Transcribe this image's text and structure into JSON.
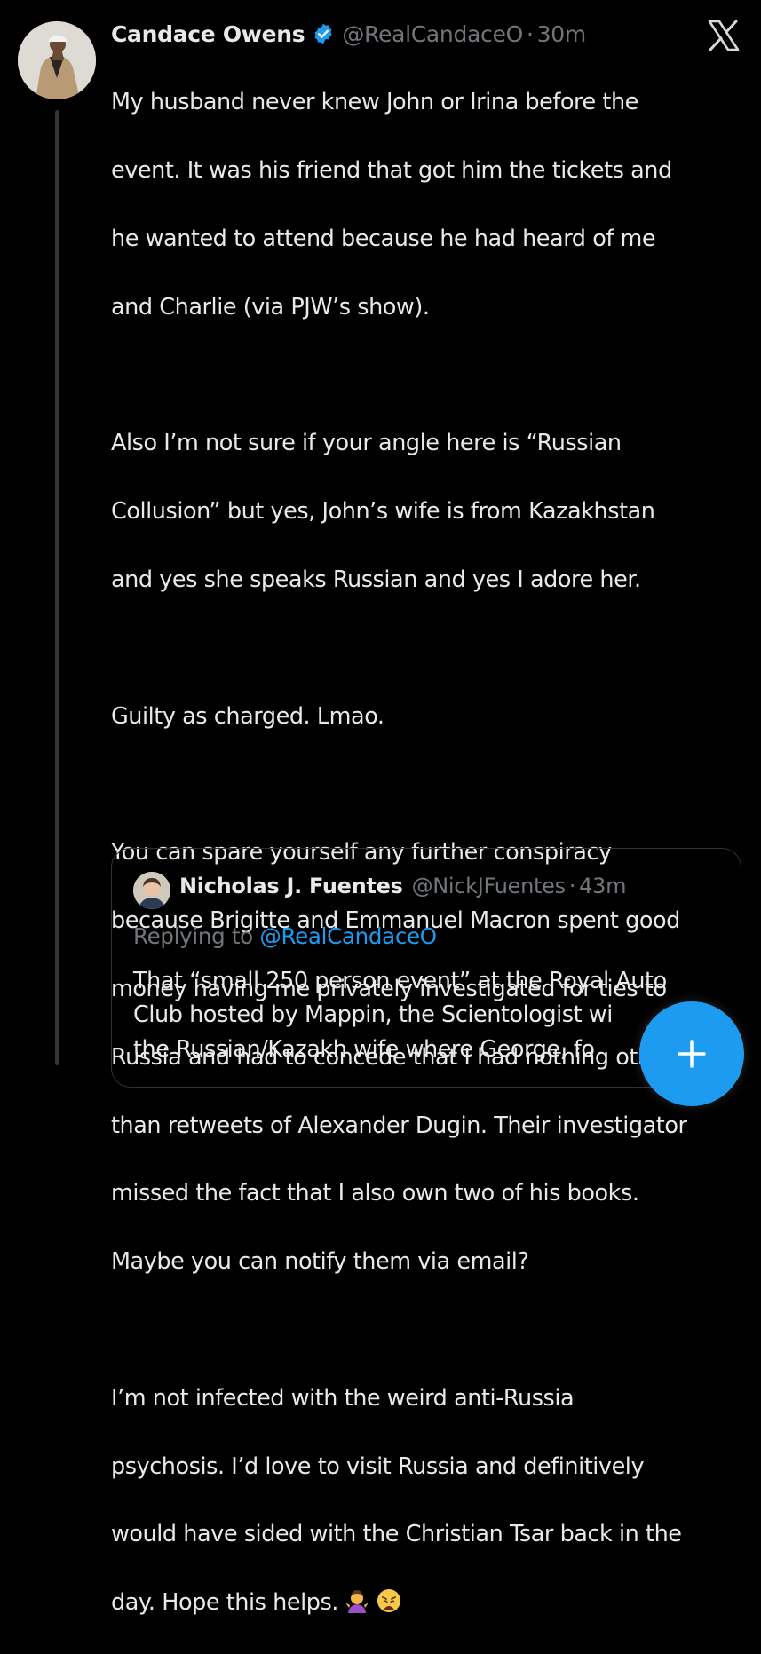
{
  "tweet": {
    "author": {
      "display_name": "Candace Owens",
      "handle": "@RealCandaceO",
      "verified_color": "#1d9bf0"
    },
    "separator": "·",
    "time": "30m",
    "lines": [
      "My husband never knew John or Irina before the",
      "event. It was his friend that got him the tickets and",
      "he wanted to attend because he had heard of me",
      "and Charlie (via PJW’s show).",
      "",
      "Also I’m not sure if your angle here is “Russian",
      "Collusion” but yes, John’s wife is from Kazakhstan",
      "and yes she speaks Russian and yes I adore her.",
      "",
      "Guilty as charged. Lmao.",
      "",
      "You can spare yourself any further conspiracy",
      "because Brigitte and Emmanuel Macron spent good",
      "money having me privately investigated for ties to",
      "Russia and had to concede that I had nothing other",
      "than retweets of Alexander Dugin. Their investigator",
      "missed the fact that I also own two of his books.",
      "Maybe you can notify them via email?",
      "",
      "I’m not infected with the weird anti-Russia",
      "psychosis. I’d love to visit Russia and definitively",
      "would have sided with the Christian Tsar back in the"
    ],
    "last_line": "day. Hope this helps.",
    "emojis": [
      "woman-shrugging-emoji",
      "weary-face-emoji"
    ]
  },
  "quoted_tweet": {
    "author": {
      "display_name": "Nicholas J. Fuentes",
      "handle": "@NickJFuentes"
    },
    "separator": "·",
    "time": "43m",
    "replying_prefix": "Replying to",
    "replying_handle": "@RealCandaceO",
    "lines": [
      "That “small 250 person event” at the Royal Auto",
      "Club hosted by Mappin, the Scientologist wi",
      "the Russian/Kazakh wife where George, fo"
    ]
  },
  "icons": {
    "close_logo": "x-logo-icon",
    "compose": "compose-plus-icon"
  },
  "colors": {
    "background": "#000000",
    "text": "#e7e9ea",
    "secondary": "#71767b",
    "accent": "#1d9bf0",
    "border": "#2f3336"
  }
}
